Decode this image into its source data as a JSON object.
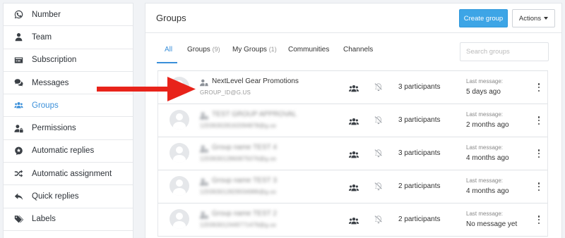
{
  "sidebar": {
    "items": [
      {
        "label": "Number",
        "icon": "whatsapp-icon"
      },
      {
        "label": "Team",
        "icon": "user-icon"
      },
      {
        "label": "Subscription",
        "icon": "credit-card-icon"
      },
      {
        "label": "Messages",
        "icon": "chat-bubbles-icon"
      },
      {
        "label": "Groups",
        "icon": "users-group-icon",
        "active": true
      },
      {
        "label": "Permissions",
        "icon": "user-lock-icon"
      },
      {
        "label": "Automatic replies",
        "icon": "robot-icon"
      },
      {
        "label": "Automatic assignment",
        "icon": "shuffle-icon"
      },
      {
        "label": "Quick replies",
        "icon": "reply-icon"
      },
      {
        "label": "Labels",
        "icon": "tags-icon"
      }
    ]
  },
  "header": {
    "title": "Groups",
    "create_label": "Create group",
    "actions_label": "Actions"
  },
  "tabs": [
    {
      "label": "All",
      "count": ""
    },
    {
      "label": "Groups",
      "count": "(9)"
    },
    {
      "label": "My Groups",
      "count": "(1)"
    },
    {
      "label": "Communities",
      "count": ""
    },
    {
      "label": "Channels",
      "count": ""
    }
  ],
  "search": {
    "placeholder": "Search groups"
  },
  "last_message_label": "Last message:",
  "groups": [
    {
      "name": "NextLevel Gear Promotions",
      "id": "GROUP_ID@G.US",
      "participants": "3 participants",
      "last_message": "5 days ago",
      "blurred": false
    },
    {
      "name": "TEST GROUP APPROVAL",
      "id": "120363028162094878@g.us",
      "participants": "3 participants",
      "last_message": "2 months ago",
      "blurred": true
    },
    {
      "name": "Group name TEST 4",
      "id": "120363012860875076@g.us",
      "participants": "3 participants",
      "last_message": "4 months ago",
      "blurred": true
    },
    {
      "name": "Group name TEST 3",
      "id": "120363012829556986@g.us",
      "participants": "2 participants",
      "last_message": "4 months ago",
      "blurred": true
    },
    {
      "name": "Group name TEST 2",
      "id": "120363012449771479@g.us",
      "participants": "2 participants",
      "last_message": "No message yet",
      "blurred": true
    }
  ],
  "colors": {
    "accent": "#3a8fd9",
    "primary_button": "#3da5e6",
    "arrow": "#e8231a"
  }
}
